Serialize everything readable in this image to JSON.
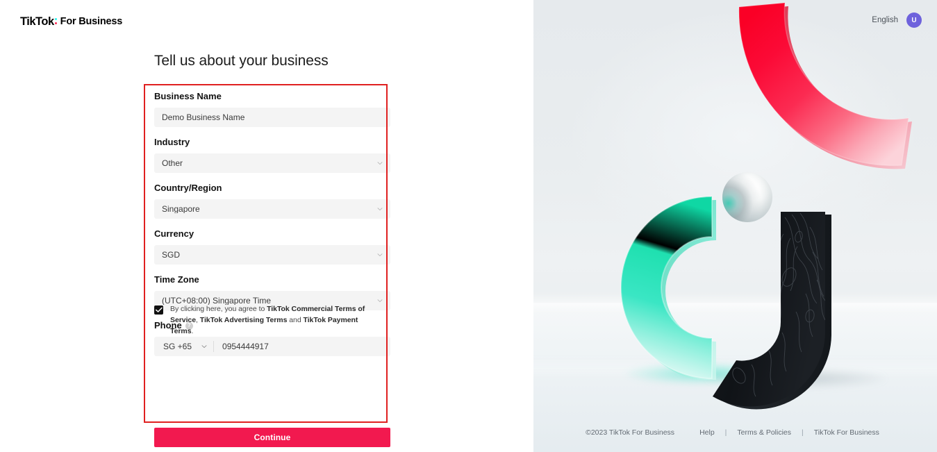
{
  "brand": {
    "name_primary": "TikTok",
    "name_secondary": "For Business",
    "dot_top_color": "#25F4EE",
    "dot_bottom_color": "#FE2C55"
  },
  "header": {
    "language_label": "English",
    "avatar_initial": "U",
    "avatar_color": "#6e62dc"
  },
  "main": {
    "title": "Tell us about your business",
    "annotation_color": "#e02020"
  },
  "form": {
    "fields": [
      {
        "key": "business_name",
        "label": "Business Name",
        "type": "text",
        "value": "Demo Business Name"
      },
      {
        "key": "industry",
        "label": "Industry",
        "type": "select",
        "value": "Other"
      },
      {
        "key": "country_region",
        "label": "Country/Region",
        "type": "select",
        "value": "Singapore"
      },
      {
        "key": "currency",
        "label": "Currency",
        "type": "select",
        "value": "SGD"
      },
      {
        "key": "time_zone",
        "label": "Time Zone",
        "type": "select",
        "value": "(UTC+08:00) Singapore Time"
      }
    ],
    "phone": {
      "label": "Phone",
      "help_icon": "question-mark-icon",
      "help_glyph": "?",
      "country_code": "SG +65",
      "number": "0954444917"
    },
    "terms": {
      "checked": true,
      "prefix": "By clicking here, you agree to ",
      "link_1": "TikTok Commercial Terms of Service",
      "between_1": ", ",
      "link_2": "TikTok Advertising Terms",
      "between_2": " and ",
      "link_3": "TikTok Payment Terms",
      "suffix": "."
    },
    "submit_label": "Continue",
    "submit_color": "#f2194f"
  },
  "footer": {
    "copyright": "©2023 TikTok For Business",
    "links": [
      {
        "label": "Help"
      },
      {
        "label": "Terms & Policies"
      },
      {
        "label": "TikTok For Business"
      }
    ],
    "separator": "|"
  },
  "illustration": {
    "description": "3D letterform composition",
    "teal_arc_color": "#17dfae",
    "black_shape_color": "#121417",
    "sphere_color": "#ffffff",
    "red_arc_color": "#fa0f3c"
  }
}
